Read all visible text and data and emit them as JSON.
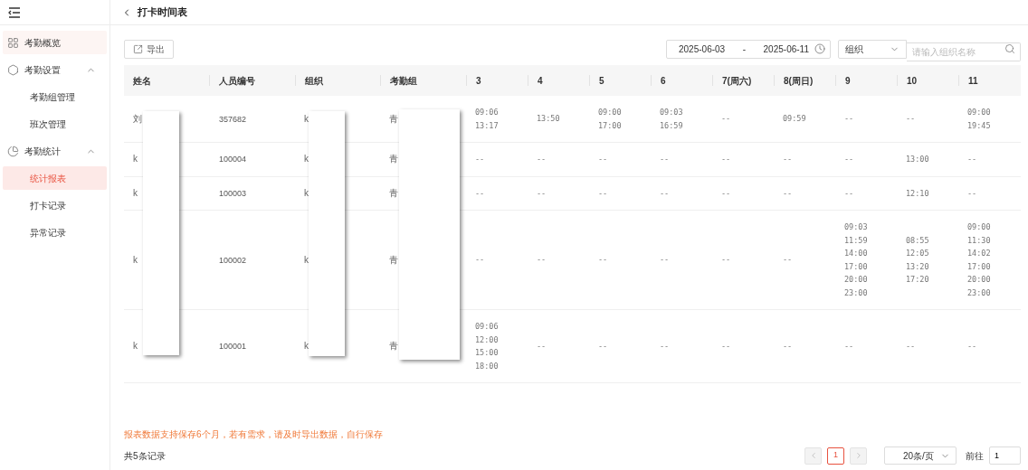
{
  "sidebar": {
    "items": [
      {
        "label": "考勤概览",
        "selected": false,
        "hovered": true
      },
      {
        "label": "考勤设置",
        "expanded": true,
        "children": [
          {
            "label": "考勤组管理",
            "selected": false
          },
          {
            "label": "班次管理",
            "selected": false
          }
        ]
      },
      {
        "label": "考勤统计",
        "expanded": true,
        "children": [
          {
            "label": "统计报表",
            "selected": true
          },
          {
            "label": "打卡记录",
            "selected": false
          },
          {
            "label": "异常记录",
            "selected": false
          }
        ]
      }
    ]
  },
  "page": {
    "title": "打卡时间表"
  },
  "toolbar": {
    "export_button": "导出",
    "date_start": "2025-06-03",
    "date_separator": "-",
    "date_end": "2025-06-11",
    "filter_select": "组织",
    "search": {
      "placeholder": "请输入组织名称"
    }
  },
  "table": {
    "columns": [
      "姓名",
      "人员编号",
      "组织",
      "考勤组",
      "3",
      "4",
      "5",
      "6",
      "7(周六)",
      "8(周日)",
      "9",
      "10",
      "11"
    ],
    "rows": [
      {
        "name": "刘",
        "id": "357682",
        "org": "k",
        "group": "青",
        "days": [
          [
            "09:06",
            "13:17"
          ],
          [
            "13:50"
          ],
          [
            "09:00",
            "17:00"
          ],
          [
            "09:03",
            "16:59"
          ],
          [
            "--"
          ],
          [
            "09:59"
          ],
          [
            "--"
          ],
          [
            "--"
          ],
          [
            "09:00",
            "19:45"
          ]
        ]
      },
      {
        "name": "k",
        "id": "100004",
        "org": "k",
        "group": "青",
        "days": [
          [
            "--"
          ],
          [
            "--"
          ],
          [
            "--"
          ],
          [
            "--"
          ],
          [
            "--"
          ],
          [
            "--"
          ],
          [
            "--"
          ],
          [
            "13:00"
          ],
          [
            "--"
          ]
        ]
      },
      {
        "name": "k",
        "id": "100003",
        "org": "k",
        "group": "青",
        "days": [
          [
            "--"
          ],
          [
            "--"
          ],
          [
            "--"
          ],
          [
            "--"
          ],
          [
            "--"
          ],
          [
            "--"
          ],
          [
            "--"
          ],
          [
            "12:10"
          ],
          [
            "--"
          ]
        ]
      },
      {
        "name": "k",
        "id": "100002",
        "org": "k",
        "group": "青",
        "days": [
          [
            "--"
          ],
          [
            "--"
          ],
          [
            "--"
          ],
          [
            "--"
          ],
          [
            "--"
          ],
          [
            "--"
          ],
          [
            "09:03",
            "11:59",
            "14:00",
            "17:00",
            "20:00",
            "23:00"
          ],
          [
            "08:55",
            "12:05",
            "13:20",
            "17:20"
          ],
          [
            "09:00",
            "11:30",
            "14:02",
            "17:00",
            "20:00",
            "23:00"
          ]
        ]
      },
      {
        "name": "k",
        "id": "100001",
        "org": "k",
        "group": "青",
        "days": [
          [
            "09:06",
            "12:00",
            "15:00",
            "18:00"
          ],
          [
            "--"
          ],
          [
            "--"
          ],
          [
            "--"
          ],
          [
            "--"
          ],
          [
            "--"
          ],
          [
            "--"
          ],
          [
            "--"
          ],
          [
            "--"
          ]
        ]
      }
    ]
  },
  "notice": "报表数据支持保存6个月，若有需求，请及时导出数据，自行保存",
  "footer": {
    "total": "共5条记录",
    "pages": [
      {
        "label": "1",
        "selected": true
      }
    ],
    "page_size": "20条/页",
    "goto_label": "前往",
    "goto_value": "1"
  }
}
